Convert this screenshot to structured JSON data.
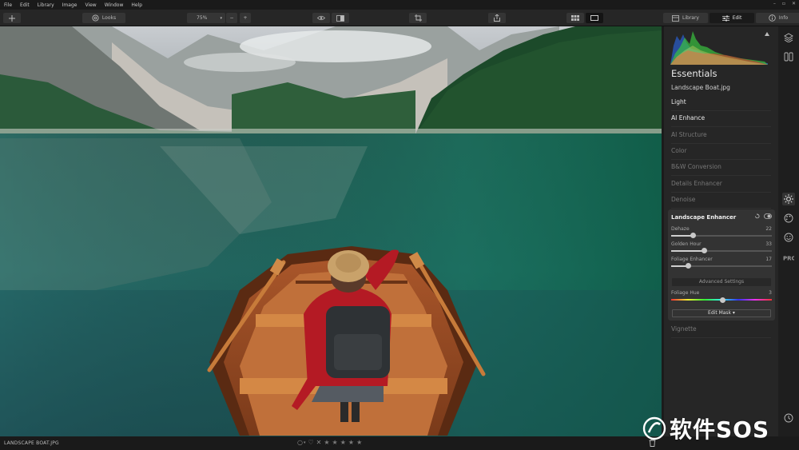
{
  "menu": [
    "File",
    "Edit",
    "Library",
    "Image",
    "View",
    "Window",
    "Help"
  ],
  "toolbar": {
    "looks_label": "Looks",
    "zoom_value": "75%",
    "minus": "−",
    "plus": "+",
    "tabs": [
      {
        "label": "Library",
        "icon": "library-icon"
      },
      {
        "label": "Edit",
        "icon": "sliders-icon"
      },
      {
        "label": "Info",
        "icon": "info-icon"
      }
    ]
  },
  "panel": {
    "section_title": "Essentials",
    "file_name": "Landscape Boat.jpg",
    "tools": [
      "Light",
      "AI Enhance",
      "AI Structure",
      "Color",
      "B&W Conversion",
      "Details Enhancer",
      "Denoise"
    ],
    "after_tool": "Vignette",
    "enhancer": {
      "title": "Landscape Enhancer",
      "sliders": [
        {
          "label": "Dehaze",
          "value": "22",
          "fraction": 0.22
        },
        {
          "label": "Golden Hour",
          "value": "33",
          "fraction": 0.33
        },
        {
          "label": "Foliage Enhancer",
          "value": "17",
          "fraction": 0.17
        }
      ],
      "advanced_label": "Advanced Settings",
      "hue": {
        "label": "Foliage Hue",
        "value": "3",
        "fraction": 0.515
      },
      "mask_label": "Edit Mask ▾"
    }
  },
  "status": {
    "file_name": "LANDSCAPE BOAT.JPG",
    "stars": [
      "★",
      "★",
      "★",
      "★",
      "★"
    ],
    "reject": "✕",
    "circle": "○",
    "heart": "♡"
  },
  "watermark": {
    "text": "软件SOS"
  },
  "colors": {
    "accent_teal": "#1f6a62",
    "panel": "#262626",
    "enhancer_bg": "#333333"
  }
}
